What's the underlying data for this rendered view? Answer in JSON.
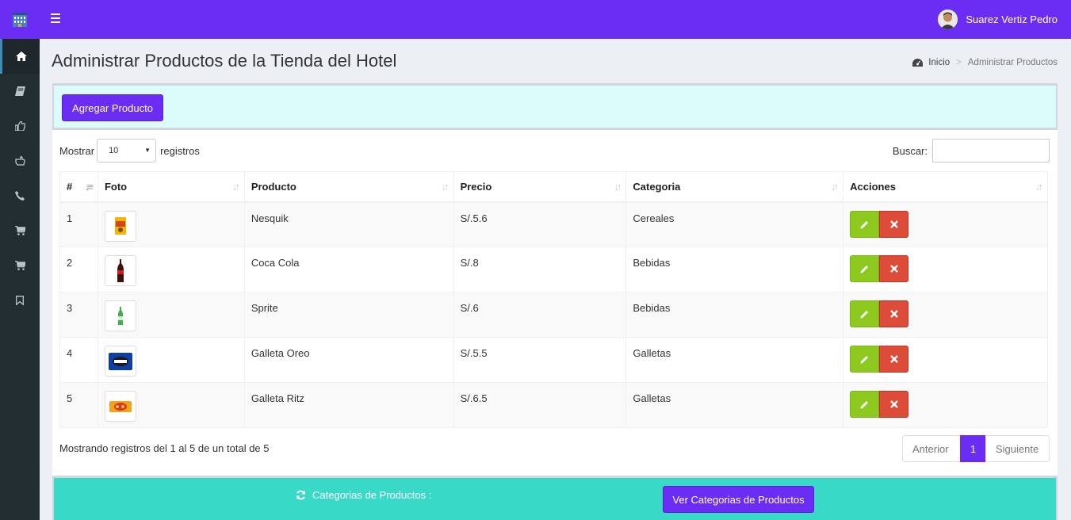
{
  "user": {
    "name": "Suarez Vertiz Pedro"
  },
  "sidebar": {
    "items": [
      {
        "icon": "home-icon"
      },
      {
        "icon": "book-icon"
      },
      {
        "icon": "thumbs-up-icon"
      },
      {
        "icon": "hand-pointing-icon"
      },
      {
        "icon": "phone-icon"
      },
      {
        "icon": "cart-icon"
      },
      {
        "icon": "cart-icon"
      },
      {
        "icon": "bookmark-icon"
      }
    ]
  },
  "page": {
    "title": "Administrar Productos de la Tienda del Hotel"
  },
  "breadcrumb": {
    "home": "Inicio",
    "current": "Administrar Productos"
  },
  "add_button": "Agregar Producto",
  "table_controls": {
    "show_label": "Mostrar",
    "show_value": "10",
    "records_label": "registros",
    "search_label": "Buscar:",
    "search_value": ""
  },
  "table": {
    "headers": [
      "#",
      "Foto",
      "Producto",
      "Precio",
      "Categoria",
      "Acciones"
    ],
    "rows": [
      {
        "id": "1",
        "product": "Nesquik",
        "price": "S/.5.6",
        "category": "Cereales"
      },
      {
        "id": "2",
        "product": "Coca Cola",
        "price": "S/.8",
        "category": "Bebidas"
      },
      {
        "id": "3",
        "product": "Sprite",
        "price": "S/.6",
        "category": "Bebidas"
      },
      {
        "id": "4",
        "product": "Galleta Oreo",
        "price": "S/.5.5",
        "category": "Galletas"
      },
      {
        "id": "5",
        "product": "Galleta Ritz",
        "price": "S/.6.5",
        "category": "Galletas"
      }
    ]
  },
  "info": "Mostrando registros del 1 al 5 de un total de 5",
  "pagination": {
    "prev": "Anterior",
    "current": "1",
    "next": "Siguiente"
  },
  "categories": {
    "label": "Categorias de Productos :",
    "button": "Ver Categorias de Productos"
  },
  "colors": {
    "brand": "#6b2df3",
    "edit": "#8ec91f",
    "delete": "#dd4b39",
    "category_box": "#39d9c8",
    "add_box": "#dcfbfb"
  }
}
